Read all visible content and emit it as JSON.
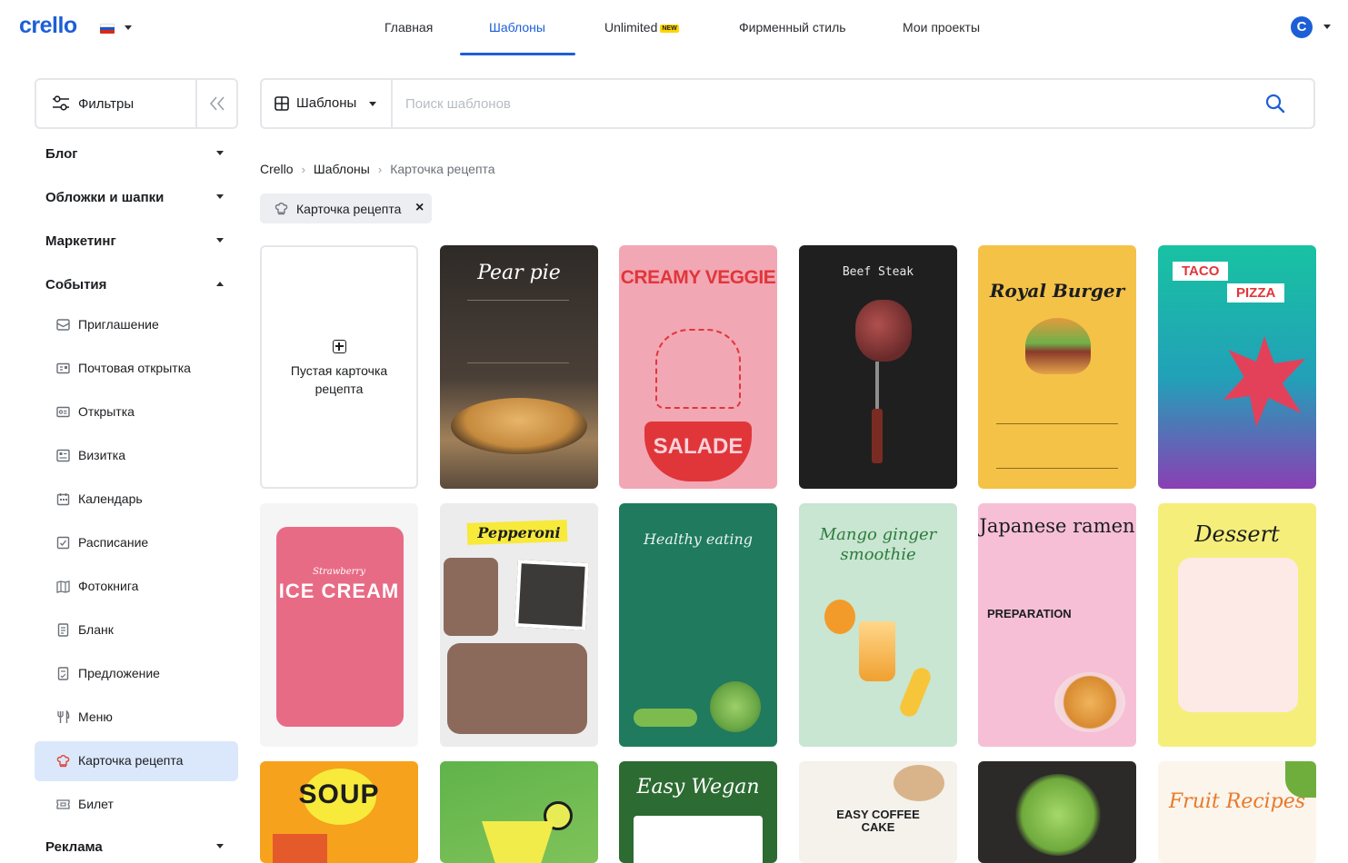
{
  "header": {
    "logo": "crello",
    "nav": [
      {
        "label": "Главная"
      },
      {
        "label": "Шаблоны"
      },
      {
        "label": "Unlimited",
        "badge": "NEW"
      },
      {
        "label": "Фирменный стиль"
      },
      {
        "label": "Мои проекты"
      }
    ],
    "active_tab": "Шаблоны",
    "avatar_letter": "C",
    "flag": "russia-flag-icon"
  },
  "filters": {
    "label": "Фильтры",
    "collapse_icon": "chevrons-left-icon"
  },
  "sidebar": {
    "sections": [
      {
        "label": "Блог",
        "state": "collapsed"
      },
      {
        "label": "Обложки и шапки",
        "state": "collapsed"
      },
      {
        "label": "Маркетинг",
        "state": "collapsed"
      },
      {
        "label": "События",
        "state": "expanded"
      },
      {
        "label": "Реклама",
        "state": "collapsed"
      }
    ],
    "items": [
      {
        "label": "Приглашение",
        "icon": "envelope-icon"
      },
      {
        "label": "Почтовая открытка",
        "icon": "postcard-icon"
      },
      {
        "label": "Открытка",
        "icon": "card-icon"
      },
      {
        "label": "Визитка",
        "icon": "business-card-icon"
      },
      {
        "label": "Календарь",
        "icon": "calendar-icon"
      },
      {
        "label": "Расписание",
        "icon": "schedule-icon"
      },
      {
        "label": "Фотокнига",
        "icon": "photobook-icon"
      },
      {
        "label": "Бланк",
        "icon": "document-icon"
      },
      {
        "label": "Предложение",
        "icon": "proposal-icon"
      },
      {
        "label": "Меню",
        "icon": "fork-knife-icon"
      },
      {
        "label": "Карточка рецепта",
        "icon": "chef-hat-icon",
        "selected": true
      },
      {
        "label": "Билет",
        "icon": "ticket-icon"
      }
    ]
  },
  "search": {
    "category": "Шаблоны",
    "placeholder": "Поиск шаблонов",
    "value": ""
  },
  "breadcrumb": [
    "Crello",
    "Шаблоны",
    "Карточка рецепта"
  ],
  "chip": {
    "label": "Карточка рецепта"
  },
  "blank_card": {
    "label": "Пустая карточка рецепта"
  },
  "templates": [
    {
      "title": "Pear pie",
      "bg": "#3a3531"
    },
    {
      "title": "CREAMY VEGGIE",
      "bottom": "SALADE",
      "bg": "#f2a7b4"
    },
    {
      "title": "Beef Steak",
      "bg": "#222222"
    },
    {
      "title": "Royal Burger",
      "bg": "#f4c247"
    },
    {
      "title": "TACO",
      "sub": "PIZZA",
      "bg": "#1fb9a2"
    },
    {
      "title": "ICE CREAM",
      "sub": "Strawberry",
      "bg": "#e86b86"
    },
    {
      "title": "Pepperoni",
      "bg": "#ececec"
    },
    {
      "title": "Healthy eating",
      "bg": "#1f7a5e"
    },
    {
      "title": "Mango ginger smoothie",
      "bg": "#c8e6d1"
    },
    {
      "title": "Japanese ramen",
      "sub": "PREPARATION",
      "bg": "#f6bfd6"
    },
    {
      "title": "Dessert",
      "bg": "#f5ee7a"
    },
    {
      "title": "SOUP",
      "bg": "#f6a21c"
    },
    {
      "title": "",
      "bg": "#5fb34a"
    },
    {
      "title": "Easy Wegan",
      "bg": "#2c6b32"
    },
    {
      "title": "EASY COFFEE CAKE",
      "bg": "#f5f1eb"
    },
    {
      "title": "",
      "bg": "#2b2a28"
    },
    {
      "title": "Fruit Recipes",
      "bg": "#fbf5ec"
    }
  ],
  "colors": {
    "accent": "#1c5fd6",
    "selected_bg": "#dbe8fb"
  }
}
